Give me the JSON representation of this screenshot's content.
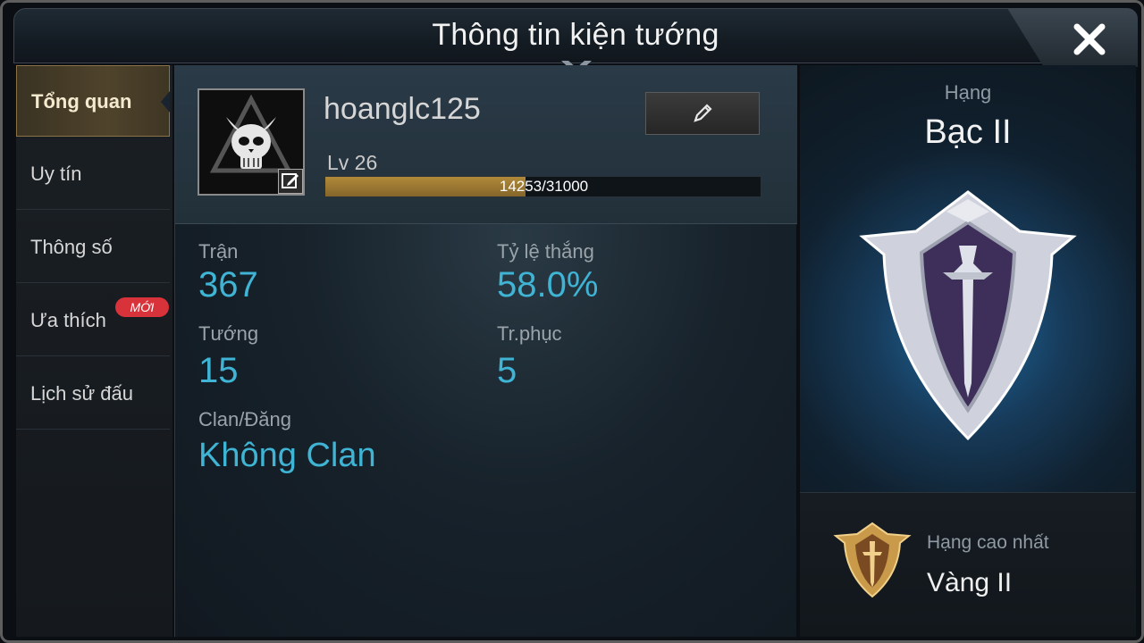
{
  "window": {
    "title": "Thông tin kiện tướng"
  },
  "sidebar": {
    "items": [
      {
        "label": "Tổng quan",
        "active": true
      },
      {
        "label": "Uy tín"
      },
      {
        "label": "Thông số"
      },
      {
        "label": "Ưa thích"
      },
      {
        "label": "Lịch sử đấu"
      }
    ],
    "new_badge": "MỚI"
  },
  "profile": {
    "username": "hoanglc125",
    "level": "Lv 26",
    "xp_text": "14253/31000",
    "xp_fraction": 0.46
  },
  "stats": {
    "matches_label": "Trận",
    "matches_value": "367",
    "winrate_label": "Tỷ lệ thắng",
    "winrate_value": "58.0%",
    "heroes_label": "Tướng",
    "heroes_value": "15",
    "skins_label": "Tr.phục",
    "skins_value": "5",
    "clan_label": "Clan/Đăng",
    "clan_value": "Không Clan"
  },
  "rank": {
    "label": "Hạng",
    "name": "Bạc II",
    "best_label": "Hạng cao nhất",
    "best_name": "Vàng II"
  },
  "colors": {
    "accent_value": "#3fb4d4",
    "active_tab": "#4f432b",
    "badge": "#d8323a",
    "xp_fill": "#b08a3a"
  },
  "icons": {
    "close": "close-icon",
    "edit": "pencil-icon",
    "avatar": "skull-avatar-icon",
    "rank": "silver-shield-emblem",
    "best_rank": "gold-shield-emblem"
  }
}
